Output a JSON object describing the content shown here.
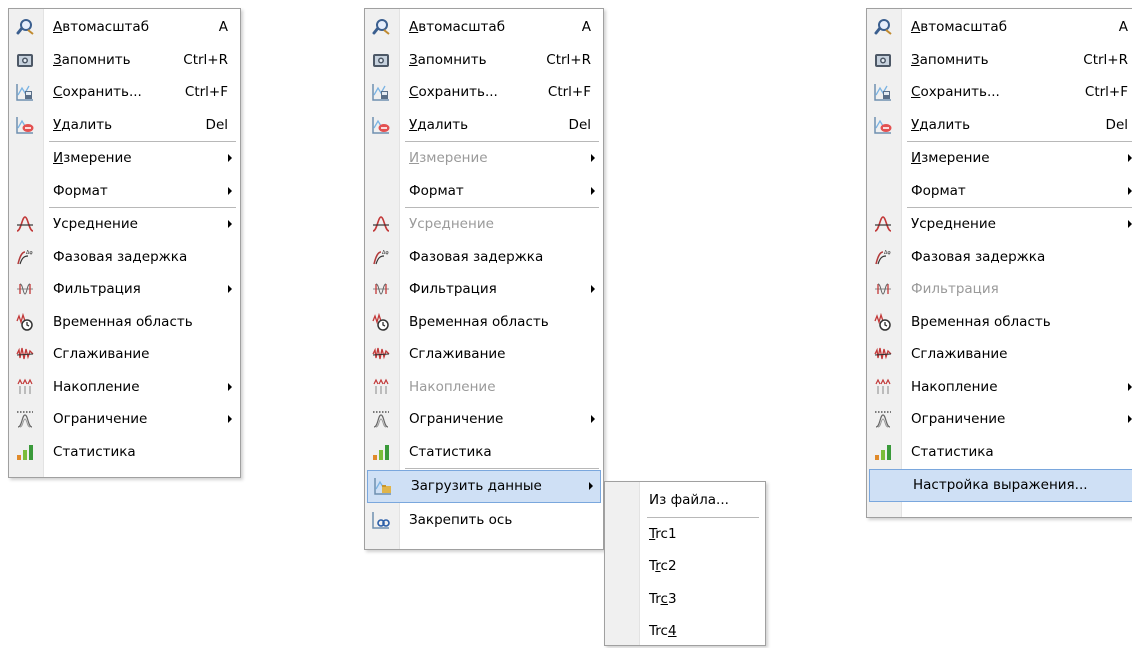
{
  "menu1": {
    "items": [
      {
        "icon": "autoscale-icon",
        "pre": "",
        "ul": "А",
        "post": "втомасштаб",
        "shortcut": "A"
      },
      {
        "icon": "camera-icon",
        "pre": "",
        "ul": "З",
        "post": "апомнить",
        "shortcut": "Ctrl+R"
      },
      {
        "icon": "save-chart-icon",
        "pre": "",
        "ul": "С",
        "post": "охранить...",
        "shortcut": "Ctrl+F"
      },
      {
        "icon": "delete-chart-icon",
        "pre": "",
        "ul": "У",
        "post": "далить",
        "shortcut": "Del"
      },
      {
        "sep": true
      },
      {
        "pre": "",
        "ul": "И",
        "post": "змерение",
        "submenu": true
      },
      {
        "pre": "Формат",
        "ul": "",
        "post": "",
        "submenu": true
      },
      {
        "sep": true
      },
      {
        "icon": "averaging-icon",
        "pre": "Усреднение",
        "ul": "",
        "post": "",
        "submenu": true
      },
      {
        "icon": "phase-delay-icon",
        "pre": "Фазовая задержка",
        "ul": "",
        "post": ""
      },
      {
        "icon": "filter-icon",
        "pre": "Фильтрация",
        "ul": "",
        "post": "",
        "submenu": true
      },
      {
        "icon": "time-domain-icon",
        "pre": "Временная область",
        "ul": "",
        "post": ""
      },
      {
        "icon": "smoothing-icon",
        "pre": "Сглаживание",
        "ul": "",
        "post": ""
      },
      {
        "icon": "accumulation-icon",
        "pre": "Накопление",
        "ul": "",
        "post": "",
        "submenu": true
      },
      {
        "icon": "limit-icon",
        "pre": "Ограничение",
        "ul": "",
        "post": "",
        "submenu": true
      },
      {
        "icon": "statistics-icon",
        "pre": "Статистика",
        "ul": "",
        "post": ""
      }
    ]
  },
  "menu2": {
    "items": [
      {
        "icon": "autoscale-icon",
        "pre": "",
        "ul": "А",
        "post": "втомасштаб",
        "shortcut": "A"
      },
      {
        "icon": "camera-icon",
        "pre": "",
        "ul": "З",
        "post": "апомнить",
        "shortcut": "Ctrl+R"
      },
      {
        "icon": "save-chart-icon",
        "pre": "",
        "ul": "С",
        "post": "охранить...",
        "shortcut": "Ctrl+F"
      },
      {
        "icon": "delete-chart-icon",
        "pre": "",
        "ul": "У",
        "post": "далить",
        "shortcut": "Del"
      },
      {
        "sep": true
      },
      {
        "pre": "",
        "ul": "И",
        "post": "змерение",
        "submenu": true,
        "disabled": true
      },
      {
        "pre": "Формат",
        "ul": "",
        "post": "",
        "submenu": true
      },
      {
        "sep": true
      },
      {
        "icon": "averaging-icon",
        "pre": "Усреднение",
        "ul": "",
        "post": "",
        "disabled": true
      },
      {
        "icon": "phase-delay-icon",
        "pre": "Фазовая задержка",
        "ul": "",
        "post": ""
      },
      {
        "icon": "filter-icon",
        "pre": "Фильтрация",
        "ul": "",
        "post": "",
        "submenu": true
      },
      {
        "icon": "time-domain-icon",
        "pre": "Временная область",
        "ul": "",
        "post": ""
      },
      {
        "icon": "smoothing-icon",
        "pre": "Сглаживание",
        "ul": "",
        "post": ""
      },
      {
        "icon": "accumulation-icon",
        "pre": "Накопление",
        "ul": "",
        "post": "",
        "disabled": true
      },
      {
        "icon": "limit-icon",
        "pre": "Ограничение",
        "ul": "",
        "post": "",
        "submenu": true
      },
      {
        "icon": "statistics-icon",
        "pre": "Статистика",
        "ul": "",
        "post": ""
      },
      {
        "sep": true
      },
      {
        "icon": "load-data-icon",
        "pre": "Загрузить данные",
        "ul": "",
        "post": "",
        "submenu": true,
        "highlight": true
      },
      {
        "icon": "pin-axis-icon",
        "pre": "Закрепить ось",
        "ul": "",
        "post": ""
      }
    ]
  },
  "submenu": {
    "items": [
      {
        "pre": "Из файла...",
        "ul": "",
        "post": ""
      },
      {
        "sep": true
      },
      {
        "pre": "",
        "ul": "T",
        "post": "rc1"
      },
      {
        "pre": "T",
        "ul": "r",
        "post": "c2"
      },
      {
        "pre": "Tr",
        "ul": "c",
        "post": "3"
      },
      {
        "pre": "Trc",
        "ul": "4",
        "post": ""
      }
    ]
  },
  "menu3": {
    "items": [
      {
        "icon": "autoscale-icon",
        "pre": "",
        "ul": "А",
        "post": "втомасштаб",
        "shortcut": "A"
      },
      {
        "icon": "camera-icon",
        "pre": "",
        "ul": "З",
        "post": "апомнить",
        "shortcut": "Ctrl+R"
      },
      {
        "icon": "save-chart-icon",
        "pre": "",
        "ul": "С",
        "post": "охранить...",
        "shortcut": "Ctrl+F"
      },
      {
        "icon": "delete-chart-icon",
        "pre": "",
        "ul": "У",
        "post": "далить",
        "shortcut": "Del"
      },
      {
        "sep": true
      },
      {
        "pre": "",
        "ul": "И",
        "post": "змерение",
        "submenu": true
      },
      {
        "pre": "Формат",
        "ul": "",
        "post": "",
        "submenu": true
      },
      {
        "sep": true
      },
      {
        "icon": "averaging-icon",
        "pre": "Усреднение",
        "ul": "",
        "post": "",
        "submenu": true
      },
      {
        "icon": "phase-delay-icon",
        "pre": "Фазовая задержка",
        "ul": "",
        "post": ""
      },
      {
        "icon": "filter-icon",
        "pre": "Фильтрация",
        "ul": "",
        "post": "",
        "disabled": true
      },
      {
        "icon": "time-domain-icon",
        "pre": "Временная область",
        "ul": "",
        "post": ""
      },
      {
        "icon": "smoothing-icon",
        "pre": "Сглаживание",
        "ul": "",
        "post": ""
      },
      {
        "icon": "accumulation-icon",
        "pre": "Накопление",
        "ul": "",
        "post": "",
        "submenu": true
      },
      {
        "icon": "limit-icon",
        "pre": "Ограничение",
        "ul": "",
        "post": "",
        "submenu": true
      },
      {
        "icon": "statistics-icon",
        "pre": "Статистика",
        "ul": "",
        "post": ""
      },
      {
        "pre": "Настройка выражения...",
        "ul": "",
        "post": "",
        "highlight": true
      }
    ]
  }
}
